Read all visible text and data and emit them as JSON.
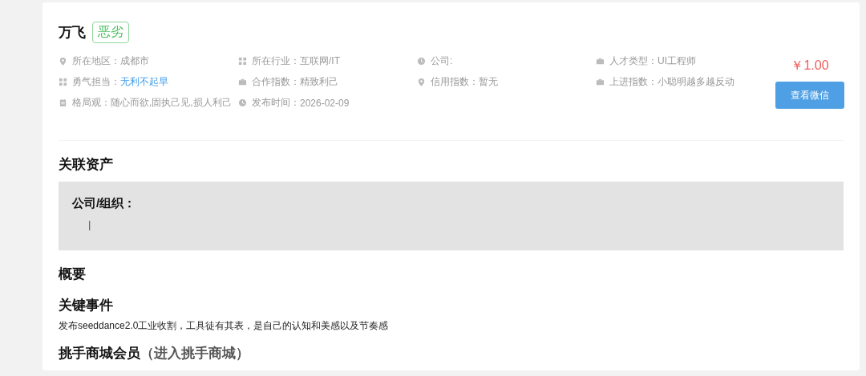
{
  "profile": {
    "name": "万飞",
    "tag": "恶劣"
  },
  "info": [
    {
      "kind": "pin",
      "label": "所在地区：",
      "value": "成都市",
      "highlighted": false
    },
    {
      "kind": "grid",
      "label": "所在行业：",
      "value": "互联网/IT",
      "highlighted": false
    },
    {
      "kind": "clock",
      "label": "公司:"
    },
    {
      "kind": "briefcase",
      "label": "人才类型：",
      "value": "UI工程师",
      "highlighted": false
    },
    {
      "kind": "grid",
      "label": "勇气担当：",
      "value": "无利不起早",
      "highlighted": true
    },
    {
      "kind": "briefcase",
      "label": "合作指数：",
      "value": "精致利己",
      "highlighted": false
    },
    {
      "kind": "pin",
      "label": "信用指数：",
      "value": "暂无",
      "highlighted": false
    },
    {
      "kind": "briefcase",
      "label": "上进指数：",
      "value": "小聪明越多越反动",
      "highlighted": false
    },
    {
      "kind": "calendar",
      "label": "格局观：",
      "value": "随心而欲,固执己见,损人利己",
      "highlighted": false
    },
    {
      "kind": "clock",
      "label": "发布时间：",
      "value": "2026-02-09",
      "highlighted": false
    }
  ],
  "price": "￥1.00",
  "action_button": "查看微信",
  "assets": {
    "title": "关联资产",
    "box_label": "公司/组织：",
    "box_value": "|"
  },
  "overview": {
    "title": "概要"
  },
  "key_events": {
    "title": "关键事件",
    "text": "发布seeddance2.0工业收割，工具徒有其表，是自己的认知和美感以及节奏感"
  },
  "membership": {
    "title": "挑手商城会员",
    "link": "（进入挑手商城）"
  }
}
